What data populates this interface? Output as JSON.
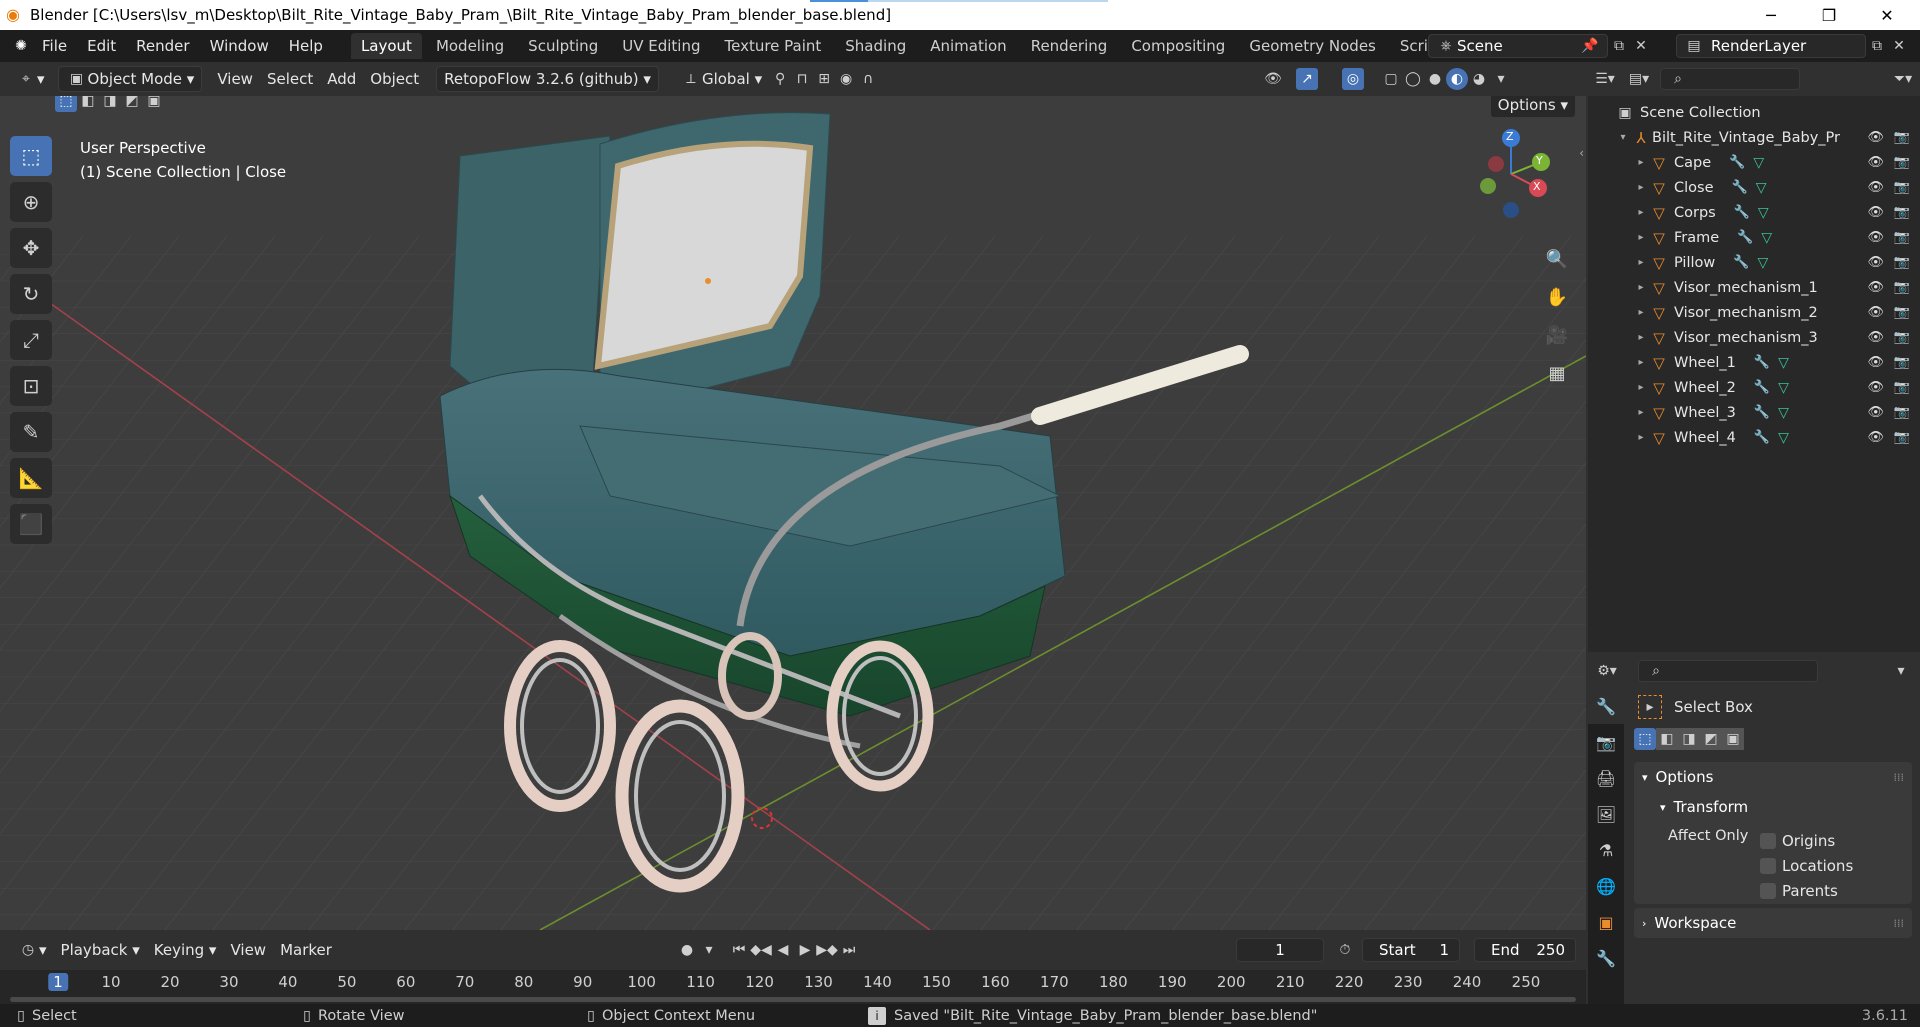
{
  "titlebar": {
    "title": "Blender [C:\\Users\\lsv_m\\Desktop\\Bilt_Rite_Vintage_Baby_Pram_\\Bilt_Rite_Vintage_Baby_Pram_blender_base.blend]"
  },
  "menubar": {
    "menus": [
      "File",
      "Edit",
      "Render",
      "Window",
      "Help"
    ],
    "workspaces": [
      "Layout",
      "Modeling",
      "Sculpting",
      "UV Editing",
      "Texture Paint",
      "Shading",
      "Animation",
      "Rendering",
      "Compositing",
      "Geometry Nodes",
      "Scripting"
    ],
    "active_workspace": "Layout",
    "scene": "Scene",
    "view_layer": "RenderLayer"
  },
  "viewport_header": {
    "mode": "Object Mode",
    "menus": [
      "View",
      "Select",
      "Add",
      "Object"
    ],
    "addon": "RetopoFlow 3.2.6 (github)",
    "orientation": "Global",
    "options": "Options"
  },
  "viewport": {
    "perspective": "User Perspective",
    "collection_info": "(1) Scene Collection | Close",
    "gizmo": {
      "z": "Z",
      "y": "Y",
      "x": "X"
    }
  },
  "outliner": {
    "root": "Scene Collection",
    "collection": "Bilt_Rite_Vintage_Baby_Pr",
    "objects": [
      {
        "name": "Cape",
        "mod": true
      },
      {
        "name": "Close",
        "mod": true
      },
      {
        "name": "Corps",
        "mod": true
      },
      {
        "name": "Frame",
        "mod": true
      },
      {
        "name": "Pillow",
        "mod": true
      },
      {
        "name": "Visor_mechanism_1",
        "mod": false
      },
      {
        "name": "Visor_mechanism_2",
        "mod": false
      },
      {
        "name": "Visor_mechanism_3",
        "mod": false
      },
      {
        "name": "Wheel_1",
        "mod": true
      },
      {
        "name": "Wheel_2",
        "mod": true
      },
      {
        "name": "Wheel_3",
        "mod": true
      },
      {
        "name": "Wheel_4",
        "mod": true
      }
    ]
  },
  "properties": {
    "tool_name": "Select Box",
    "options_label": "Options",
    "transform_label": "Transform",
    "affect_only": "Affect Only",
    "checkboxes": [
      "Origins",
      "Locations",
      "Parents"
    ],
    "workspace_label": "Workspace"
  },
  "timeline": {
    "menus": [
      "Playback",
      "Keying",
      "View",
      "Marker"
    ],
    "current_frame": "1",
    "start_label": "Start",
    "start": "1",
    "end_label": "End",
    "end": "250",
    "ticks": [
      "1",
      "10",
      "20",
      "30",
      "40",
      "50",
      "60",
      "70",
      "80",
      "90",
      "100",
      "110",
      "120",
      "130",
      "140",
      "150",
      "160",
      "170",
      "180",
      "190",
      "200",
      "210",
      "220",
      "230",
      "240",
      "250"
    ]
  },
  "statusbar": {
    "select": "Select",
    "rotate": "Rotate View",
    "context": "Object Context Menu",
    "message": "Saved \"Bilt_Rite_Vintage_Baby_Pram_blender_base.blend\"",
    "version": "3.6.11"
  },
  "colors": {
    "accent": "#4772b3",
    "object_icon": "#e98c2b",
    "modifier": "#4f8ad6",
    "vertex_group": "#39c39b",
    "pram_body": "#3f6468",
    "pram_lower": "#1f5436"
  }
}
